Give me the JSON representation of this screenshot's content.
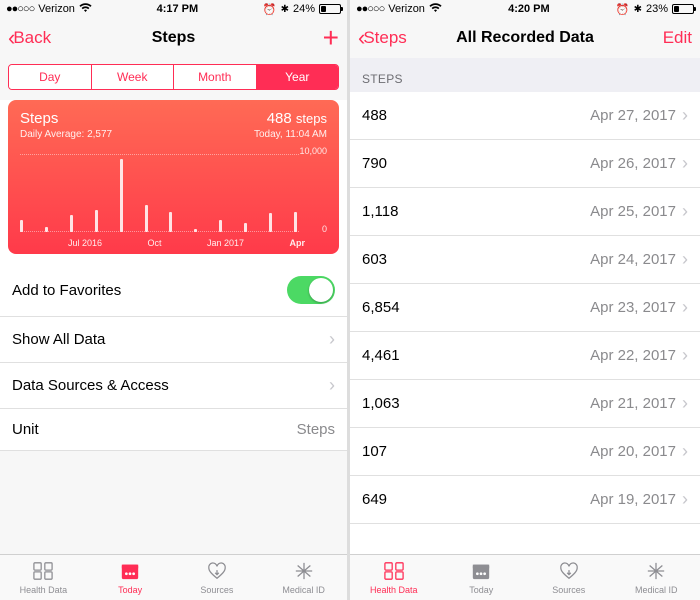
{
  "left": {
    "status": {
      "carrier": "Verizon",
      "time": "4:17 PM",
      "battery_pct": "24%",
      "battery_fill": 24
    },
    "nav": {
      "back": "Back",
      "title": "Steps"
    },
    "seg": [
      "Day",
      "Week",
      "Month",
      "Year"
    ],
    "seg_active": 3,
    "card": {
      "title": "Steps",
      "value": "488",
      "unit": "steps",
      "subtitle_l": "Daily Average: 2,577",
      "subtitle_r": "Today, 11:04 AM",
      "ytop": "10,000",
      "ybot": "0",
      "xlabels": [
        "Jul 2016",
        "Oct",
        "Jan 2017",
        "Apr"
      ]
    },
    "rows": {
      "fav": "Add to Favorites",
      "showall": "Show All Data",
      "sources": "Data Sources & Access",
      "unit_label": "Unit",
      "unit_value": "Steps"
    },
    "tabs": [
      "Health Data",
      "Today",
      "Sources",
      "Medical ID"
    ],
    "tab_active": 1
  },
  "right": {
    "status": {
      "carrier": "Verizon",
      "time": "4:20 PM",
      "battery_pct": "23%",
      "battery_fill": 23
    },
    "nav": {
      "back": "Steps",
      "title": "All Recorded Data",
      "edit": "Edit"
    },
    "section": "Steps",
    "rows": [
      {
        "value": "488",
        "date": "Apr 27, 2017"
      },
      {
        "value": "790",
        "date": "Apr 26, 2017"
      },
      {
        "value": "1,118",
        "date": "Apr 25, 2017"
      },
      {
        "value": "603",
        "date": "Apr 24, 2017"
      },
      {
        "value": "6,854",
        "date": "Apr 23, 2017"
      },
      {
        "value": "4,461",
        "date": "Apr 22, 2017"
      },
      {
        "value": "1,063",
        "date": "Apr 21, 2017"
      },
      {
        "value": "107",
        "date": "Apr 20, 2017"
      },
      {
        "value": "649",
        "date": "Apr 19, 2017"
      }
    ],
    "tabs": [
      "Health Data",
      "Today",
      "Sources",
      "Medical ID"
    ],
    "tab_active": 0
  },
  "chart_data": {
    "type": "bar",
    "title": "Steps",
    "ylabel": "steps",
    "ylim": [
      0,
      10000
    ],
    "categories": [
      "May 2016",
      "Jun 2016",
      "Jul 2016",
      "Aug 2016",
      "Sep 2016",
      "Oct 2016",
      "Nov 2016",
      "Dec 2016",
      "Jan 2017",
      "Feb 2017",
      "Mar 2017",
      "Apr 2017"
    ],
    "values": [
      1500,
      600,
      2200,
      2800,
      9400,
      3400,
      2600,
      400,
      1500,
      1100,
      2400,
      2600
    ],
    "x_tick_labels": [
      "Jul 2016",
      "Oct",
      "Jan 2017",
      "Apr"
    ],
    "annotations": {
      "daily_average": 2577,
      "latest_value": 488,
      "latest_timestamp": "Today, 11:04 AM"
    }
  },
  "tab_icons": [
    "grid-icon",
    "calendar-icon",
    "heart-down-icon",
    "medical-id-icon"
  ]
}
